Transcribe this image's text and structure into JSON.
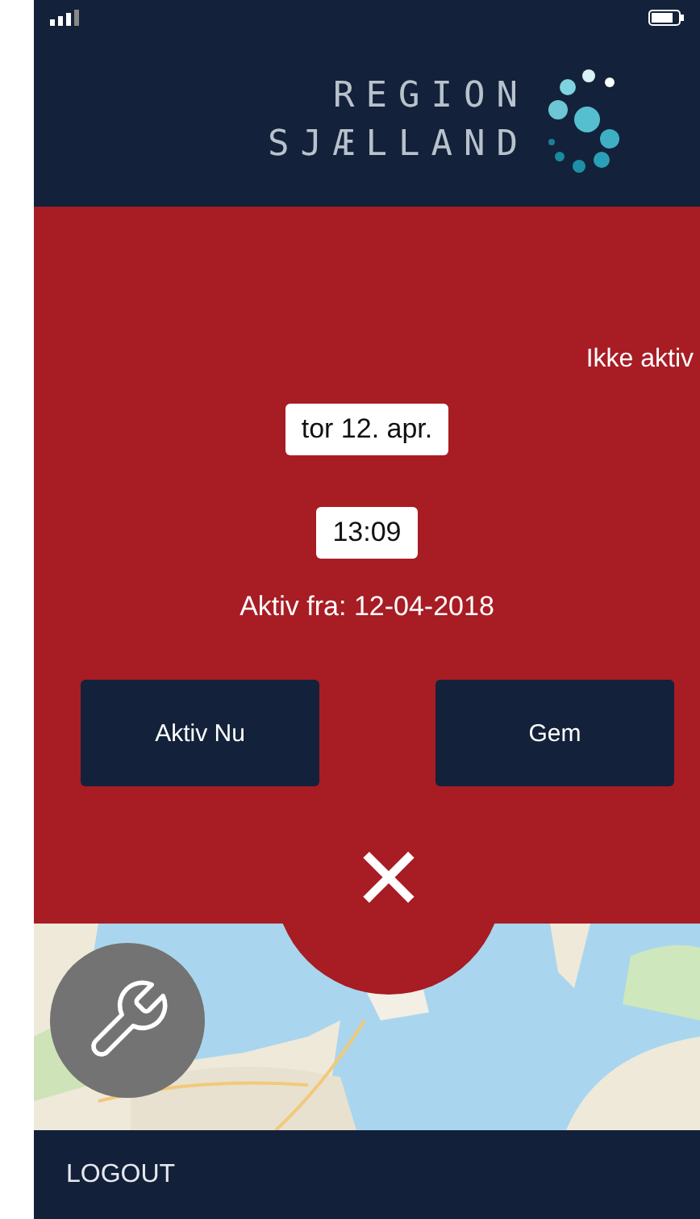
{
  "logo": {
    "line_1": "REGION",
    "line_2": "SJÆLLAND"
  },
  "status": {
    "label": "Ikke aktiv"
  },
  "date_field": {
    "value": "tor 12. apr."
  },
  "time_field": {
    "value": "13:09"
  },
  "active_from": "Aktiv fra: 12-04-2018",
  "buttons": [
    {
      "label": "Aktiv Nu"
    },
    {
      "label": "Gem"
    }
  ],
  "close_button": {
    "symbol": "✕"
  },
  "footer": {
    "logout": "LOGOUT"
  }
}
